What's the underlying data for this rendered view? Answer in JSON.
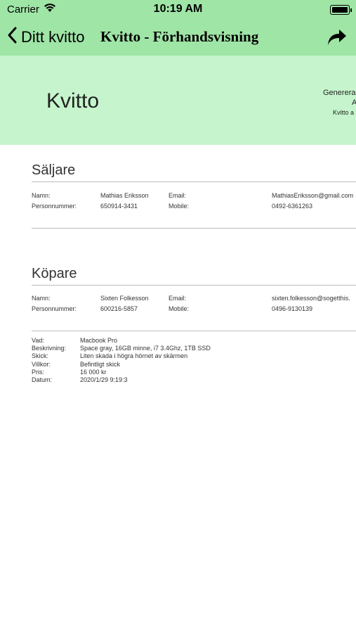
{
  "status": {
    "carrier": "Carrier",
    "time": "10:19 AM"
  },
  "nav": {
    "back_label": "Ditt kvitto",
    "title": "Kvitto - Förhandsvisning"
  },
  "receipt": {
    "title": "Kvitto",
    "generated_line1": "Generera",
    "generated_line2": "A",
    "generated_line3": "Kvitto a"
  },
  "seller": {
    "heading": "Säljare",
    "name_label": "Namn:",
    "name_value": "Mathias Eriksson",
    "email_label": "Email:",
    "email_value": "MathiasEriksson@gmail.com",
    "pnr_label": "Personnummer:",
    "pnr_value": "650914-3431",
    "mobile_label": "Mobile:",
    "mobile_value": "0492-6361263"
  },
  "buyer": {
    "heading": "Köpare",
    "name_label": "Namn:",
    "name_value": "Sixten Folkesson",
    "email_label": "Email:",
    "email_value": "sixten.folkesson@sogetthis.",
    "pnr_label": "Personnummer:",
    "pnr_value": "600216-5857",
    "mobile_label": "Mobile:",
    "mobile_value": "0496-9130139"
  },
  "item": {
    "what_label": "Vad:",
    "what_value": "Macbook Pro",
    "desc_label": "Beskrivning:",
    "desc_value": "Space gray, 16GB minne, i7 3.4Ghz, 1TB SSD",
    "cond_label": "Skick:",
    "cond_value": "Liten skada i högra hörnet av skärmen",
    "terms_label": "Villkor:",
    "terms_value": "Befintligt skick",
    "price_label": "Pris:",
    "price_value": "16 000 kr",
    "date_label": "Datum:",
    "date_value": "2020/1/29 9:19:3"
  },
  "colors": {
    "nav_bg": "#9fe5a6",
    "header_bg": "#c6f5cd"
  }
}
